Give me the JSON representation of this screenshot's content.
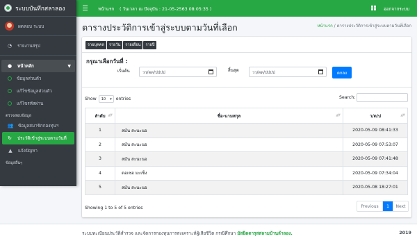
{
  "app": {
    "brand": "ระบบบันทึกสลาลอง",
    "user": "ผดลอบ ระบบ"
  },
  "topbar": {
    "home": "หน้าแรก",
    "time": "( วันเวลา ณ ปัจจุบัน : 21-05-2563 08:05:35 )",
    "logout": "ออกจากระบบ"
  },
  "sidebar": {
    "summary": "รายงานสรุป",
    "main_menu": "หน้าหลัก",
    "sub_items": [
      "ข้อมูลส่วนตัว",
      "แก้ไขข้อมูลส่วนตัว",
      "แก้ไขรหัสผ่าน"
    ],
    "section_header": "ตรวจสอบข้อมูล",
    "check_items": [
      "ข้อมูลสมาชิกกองทุนฯ",
      "ประวัติเข้าสู่ระบบตามวันที่",
      "แจ้งปัญหา"
    ],
    "bottom_header": "ข้อมูลอื่นๆ"
  },
  "page": {
    "title": "ตารางประวัติการเข้าสู่ระบบตามวันที่เลือก",
    "breadcrumb_home": "หน้าแรก",
    "breadcrumb_sep": "/",
    "breadcrumb_current": "ตารางประวัติการเข้าสู่ระบบตามวันที่เลือก"
  },
  "filters": {
    "buttons": [
      "รายบุคคล",
      "รายวัน",
      "รายเดือน",
      "รายปี"
    ],
    "title": "กรุณาเลือกวันที่ :",
    "start_label": "เริ่มต้น",
    "end_label": "สิ้นสุด",
    "start_placeholder": "วว/ดด/ปปปป",
    "end_placeholder": "วว/ดด/ปปปป",
    "search_button": "ตกลง"
  },
  "datatable": {
    "show": "Show",
    "entries_value": "10",
    "entries": "entries",
    "search_label": "Search:",
    "columns": [
      "ลำดับ",
      "ชื่อ-นามสกุล",
      "ว/ด/ป"
    ],
    "rows": [
      [
        "1",
        "สมัน สะนะนอ",
        "2020-05-09 08:41:33"
      ],
      [
        "2",
        "สมัน สะนะนอ",
        "2020-05-09 07:53:07"
      ],
      [
        "3",
        "สมัน สะนะนอ",
        "2020-05-09 07:41:48"
      ],
      [
        "4",
        "ดอเซฮ มะเซ็ง",
        "2020-05-09 07:34:04"
      ],
      [
        "5",
        "สมัน สะนะนอ",
        "2020-05-08 18:27:01"
      ]
    ],
    "info": "Showing 1 to 5 of 5 entries",
    "prev": "Previous",
    "page": "1",
    "next": "Next"
  },
  "footer": {
    "text": "ระบบทะเบียนประวัติสำรวจ และจัดการกองทุนการสงเคราะห์ผู้เสียชีวิต กรณีศึกษา",
    "highlight": "มัสยิดดารุสสลามบ้านลำลอง.",
    "year": "2019"
  },
  "colors": {
    "brand_green": "#28a745",
    "sidebar_dark": "#343a40",
    "primary_blue": "#007bff"
  }
}
